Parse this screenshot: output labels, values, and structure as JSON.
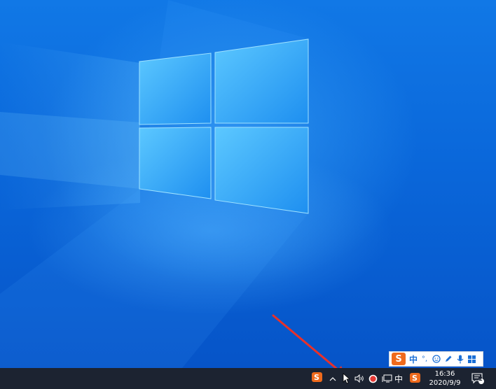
{
  "colors": {
    "taskbar": "#1c2331",
    "sogou_orange": "#ef6a1c",
    "ime_blue": "#1a6fd6",
    "arrow_red": "#e8312a",
    "record_red": "#e53935"
  },
  "tray": {
    "sogou_icon_letter": "S",
    "chevron_icon": "chevron-up-icon",
    "volume_icon": "volume-icon",
    "record_icon": "record-icon",
    "network_icon": "display-network-icon",
    "ime_language": "中",
    "sogou_tray_letter": "S"
  },
  "clock": {
    "time": "16:36",
    "date": "2020/9/9"
  },
  "notification": {
    "count": "2",
    "icon": "action-center-icon"
  },
  "ime_toolbar": {
    "logo_letter": "S",
    "mode": "中",
    "punctuation": "°,",
    "emoji_icon": "smiley-icon",
    "pen_icon": "pen-icon",
    "mic_icon": "microphone-icon",
    "grid_icon": "toolbox-icon"
  }
}
